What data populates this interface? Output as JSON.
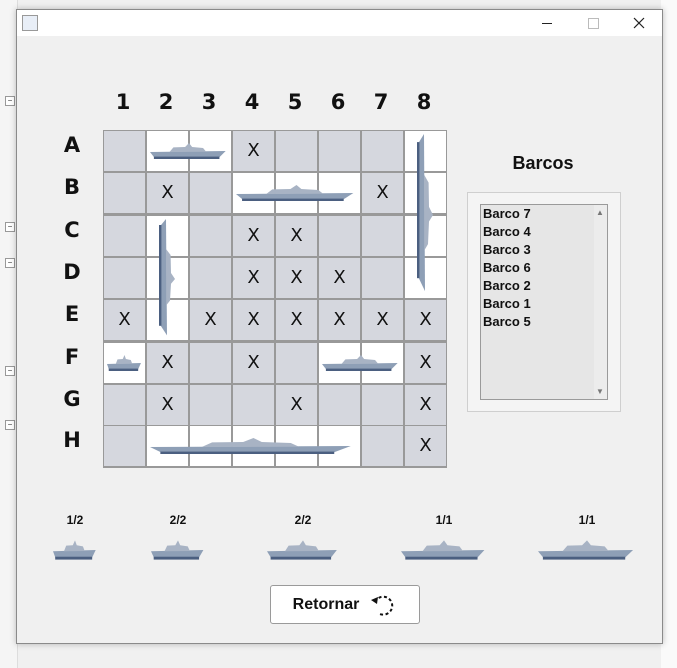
{
  "columns": [
    "1",
    "2",
    "3",
    "4",
    "5",
    "6",
    "7",
    "8"
  ],
  "rows": [
    "A",
    "B",
    "C",
    "D",
    "E",
    "F",
    "G",
    "H"
  ],
  "grid": [
    [
      "",
      "",
      "",
      "X",
      "",
      "",
      "",
      ""
    ],
    [
      "",
      "X",
      "",
      "",
      "",
      "",
      "X",
      ""
    ],
    [
      "",
      "",
      "",
      "X",
      "X",
      "",
      "",
      ""
    ],
    [
      "",
      "",
      "",
      "X",
      "X",
      "X",
      "",
      ""
    ],
    [
      "X",
      "",
      "X",
      "X",
      "X",
      "X",
      "X",
      "X"
    ],
    [
      "",
      "X",
      "",
      "X",
      "",
      "",
      "",
      "X"
    ],
    [
      "",
      "X",
      "",
      "",
      "X",
      "",
      "",
      "X"
    ],
    [
      "",
      "",
      "",
      "",
      "",
      "",
      "",
      "X"
    ]
  ],
  "white_cells": [
    [
      0,
      1
    ],
    [
      0,
      2
    ],
    [
      0,
      7
    ],
    [
      1,
      3
    ],
    [
      1,
      4
    ],
    [
      1,
      5
    ],
    [
      1,
      7
    ],
    [
      2,
      1
    ],
    [
      2,
      7
    ],
    [
      3,
      1
    ],
    [
      3,
      7
    ],
    [
      4,
      1
    ],
    [
      5,
      0
    ],
    [
      5,
      5
    ],
    [
      5,
      6
    ],
    [
      7,
      1
    ],
    [
      7,
      2
    ],
    [
      7,
      3
    ],
    [
      7,
      4
    ],
    [
      7,
      5
    ]
  ],
  "ships_list": {
    "title": "Barcos",
    "items": [
      "Barco 7",
      "Barco 4",
      "Barco 3",
      "Barco 6",
      "Barco 2",
      "Barco 1",
      "Barco 5"
    ]
  },
  "fleet": [
    {
      "count": "1/2"
    },
    {
      "count": "2/2"
    },
    {
      "count": "2/2"
    },
    {
      "count": "1/1"
    },
    {
      "count": "1/1"
    }
  ],
  "actions": {
    "return_label": "Retornar"
  },
  "colors": {
    "cell_gray": "#d5d7de",
    "cell_white": "#ffffff",
    "ship_hull": "#5a6e8c"
  }
}
